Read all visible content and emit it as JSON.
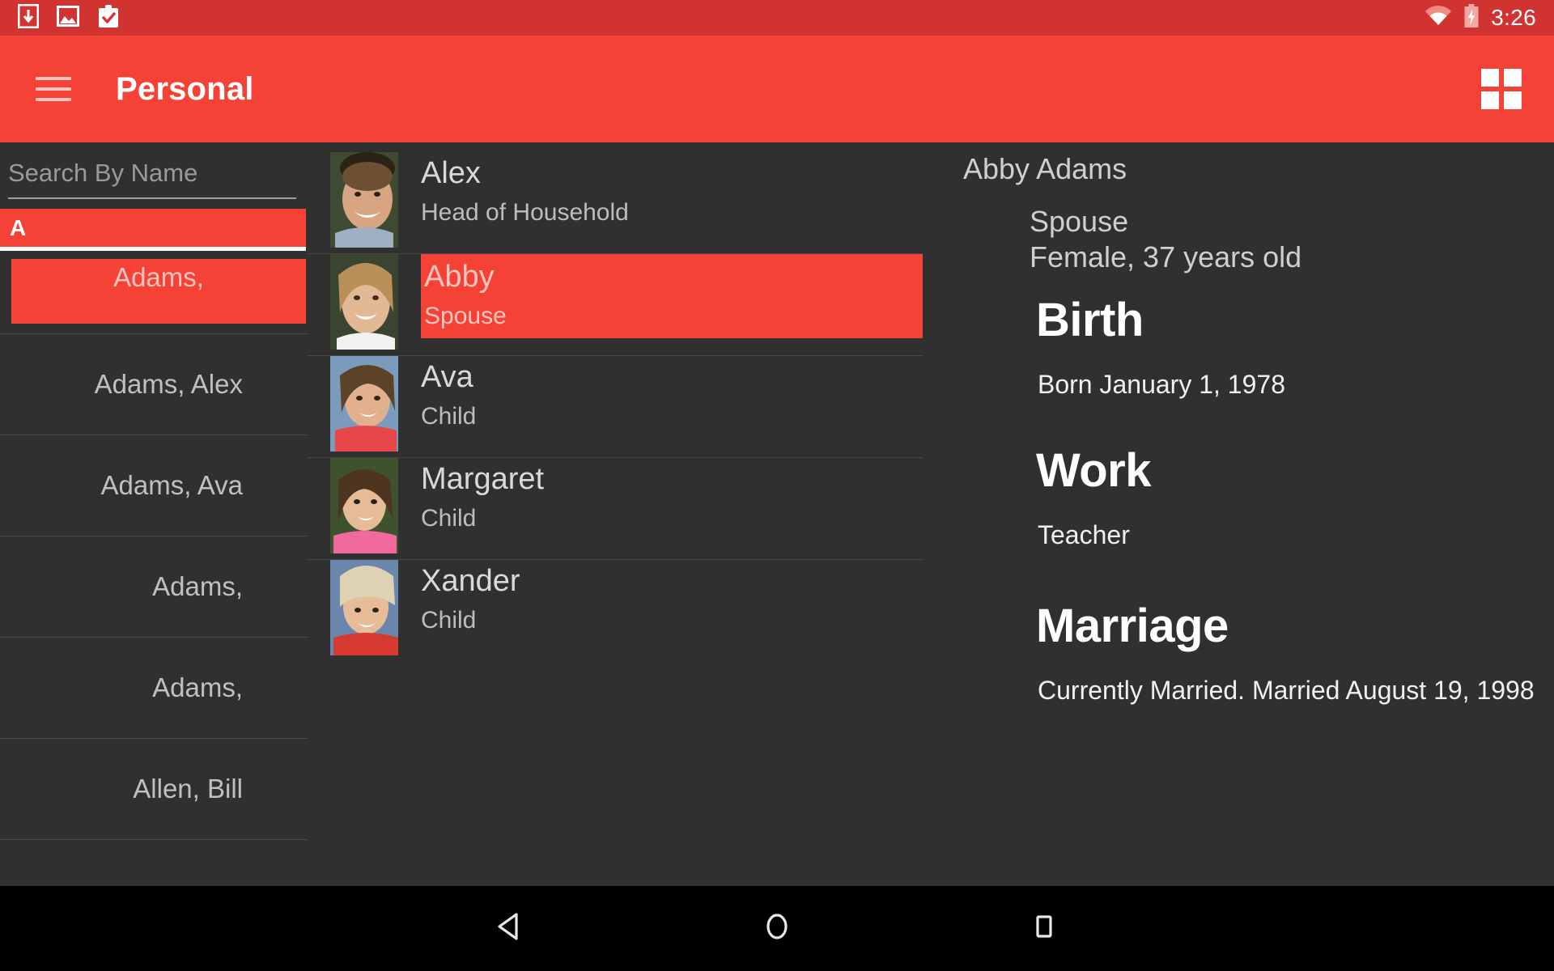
{
  "statusbar": {
    "icons": [
      "download-icon",
      "image-icon",
      "clipboard-check-icon"
    ],
    "right_icons": [
      "wifi-icon",
      "battery-charging-icon"
    ],
    "time": "3:26"
  },
  "appbar": {
    "menu_icon": "hamburger-menu-icon",
    "title": "Personal",
    "grid_icon": "grid-view-icon"
  },
  "sidebar": {
    "search": {
      "placeholder": "Search By Name",
      "value": ""
    },
    "letter_header": "A",
    "selected_item": "Adams,",
    "items": [
      {
        "label": "Adams, Alex"
      },
      {
        "label": "Adams, Ava"
      },
      {
        "label": "Adams,"
      },
      {
        "label": "Adams,"
      },
      {
        "label": "Allen, Bill"
      }
    ]
  },
  "family": {
    "members": [
      {
        "name": "Alex",
        "relation": "Head of Household",
        "selected": false,
        "avatar": "portrait-alex"
      },
      {
        "name": "Abby",
        "relation": "Spouse",
        "selected": true,
        "avatar": "portrait-abby"
      },
      {
        "name": "Ava",
        "relation": "Child",
        "selected": false,
        "avatar": "portrait-ava"
      },
      {
        "name": "Margaret",
        "relation": "Child",
        "selected": false,
        "avatar": "portrait-margaret"
      },
      {
        "name": "Xander",
        "relation": "Child",
        "selected": false,
        "avatar": "portrait-xander"
      }
    ]
  },
  "detail": {
    "full_name": "Abby Adams",
    "relation": "Spouse",
    "demographics": "Female, 37 years old",
    "sections": [
      {
        "heading": "Birth",
        "body": "Born January 1, 1978"
      },
      {
        "heading": "Work",
        "body": "Teacher"
      },
      {
        "heading": "Marriage",
        "body": "Currently Married. Married August 19, 1998"
      }
    ]
  },
  "navbar": {
    "back": "back-triangle-icon",
    "home": "home-circle-icon",
    "recents": "recents-square-icon"
  },
  "colors": {
    "status_bar": "#D13330",
    "app_bar": "#F44336",
    "accent": "#F44336",
    "background": "#303030",
    "nav_bar": "#000000"
  }
}
